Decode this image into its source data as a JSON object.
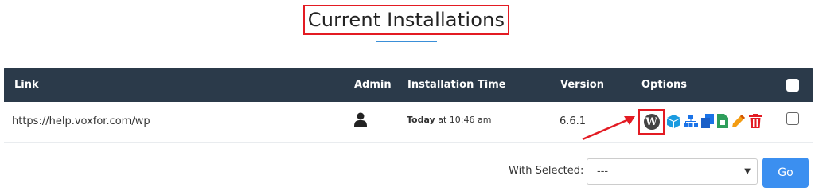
{
  "page": {
    "title": "Current Installations"
  },
  "table": {
    "headers": {
      "link": "Link",
      "admin": "Admin",
      "installation_time": "Installation Time",
      "version": "Version",
      "options": "Options"
    },
    "rows": [
      {
        "link": "https://help.voxfor.com/wp",
        "admin_icon": "user-icon",
        "time_day": "Today",
        "time_rest": "at 10:46 am",
        "version": "6.6.1"
      }
    ],
    "option_icons": [
      "wordpress-icon",
      "cube-icon",
      "sitemap-icon",
      "copy-icon",
      "file-export-icon",
      "pencil-icon",
      "trash-icon"
    ]
  },
  "footer": {
    "with_selected_label": "With Selected:",
    "select_value": "---",
    "go_label": "Go"
  },
  "colors": {
    "header_bg": "#2b3a4a",
    "accent_blue": "#3a8fd8",
    "highlight_red": "#e31b23",
    "go_button": "#3b8ff0"
  }
}
